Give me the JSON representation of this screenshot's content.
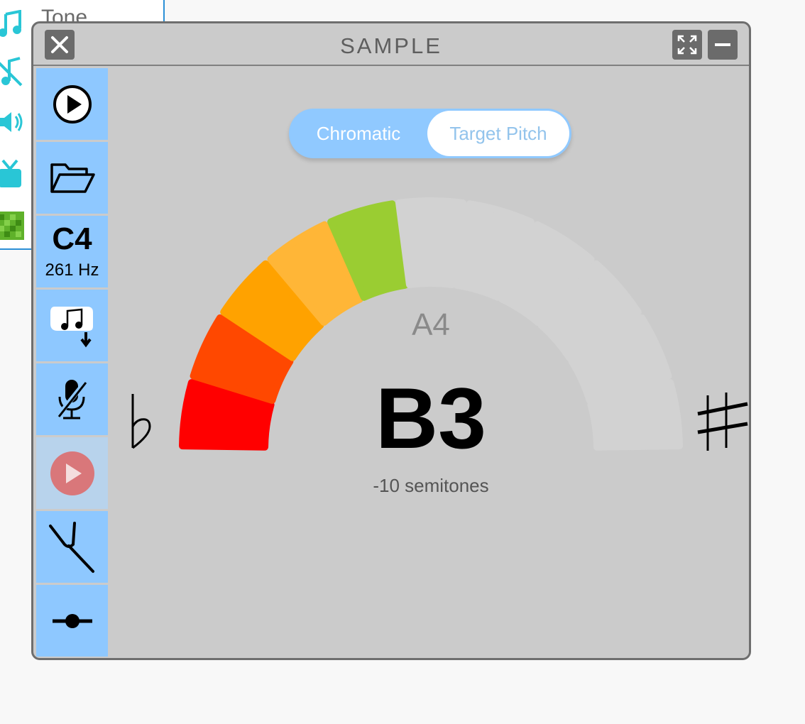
{
  "background": {
    "palette_label": "Tone"
  },
  "window": {
    "title": "SAMPLE",
    "close_icon": "close-icon",
    "expand_icon": "expand-icon",
    "minimize_icon": "minimize-icon"
  },
  "sidebar": {
    "items": [
      {
        "name": "play",
        "icon": "play-icon"
      },
      {
        "name": "open",
        "icon": "folder-open-icon"
      },
      {
        "name": "pitch",
        "note": "C4",
        "hz": "261 Hz"
      },
      {
        "name": "export",
        "icon": "notes-download-icon"
      },
      {
        "name": "mic",
        "icon": "mic-off-icon"
      },
      {
        "name": "play-recording",
        "icon": "play-red-icon"
      },
      {
        "name": "tuning-fork",
        "icon": "tuning-fork-icon"
      },
      {
        "name": "slider",
        "icon": "slider-icon"
      }
    ]
  },
  "mode": {
    "options": [
      "Chromatic",
      "Target Pitch"
    ],
    "selected": "Target Pitch"
  },
  "tuner": {
    "target_note": "A4",
    "detected_note": "B3",
    "offset_text": "-10 semitones",
    "flat_symbol": "flat-icon",
    "sharp_symbol": "sharp-icon",
    "segment_colors": [
      "#ff0000",
      "#ff4800",
      "#ffa200",
      "#ffb637",
      "#9acd32",
      "#d3d3d3",
      "#d3d3d3",
      "#d3d3d3",
      "#d3d3d3",
      "#d3d3d3",
      "#d3d3d3"
    ],
    "active_segments": 5
  }
}
